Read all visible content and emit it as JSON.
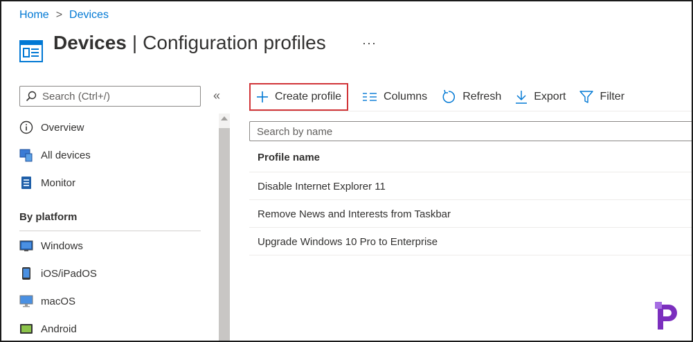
{
  "breadcrumb": {
    "home": "Home",
    "separator": ">",
    "current": "Devices"
  },
  "header": {
    "title_bold": "Devices",
    "title_bar": "|",
    "title_rest": "Configuration profiles",
    "more": "···",
    "icon": "configuration-profile-icon"
  },
  "nav": {
    "search_placeholder": "Search (Ctrl+/)",
    "collapse": "«",
    "items": [
      {
        "label": "Overview",
        "icon": "info-icon"
      },
      {
        "label": "All devices",
        "icon": "devices-icon"
      },
      {
        "label": "Monitor",
        "icon": "monitor-icon"
      }
    ],
    "section": "By platform",
    "platforms": [
      {
        "label": "Windows",
        "icon": "windows-icon"
      },
      {
        "label": "iOS/iPadOS",
        "icon": "ios-icon"
      },
      {
        "label": "macOS",
        "icon": "macos-icon"
      },
      {
        "label": "Android",
        "icon": "android-icon"
      }
    ]
  },
  "toolbar": {
    "create": "Create profile",
    "columns": "Columns",
    "refresh": "Refresh",
    "export": "Export",
    "filter": "Filter"
  },
  "main": {
    "search_placeholder": "Search by name",
    "column_header": "Profile name",
    "rows": [
      "Disable Internet Explorer 11",
      "Remove News and Interests from Taskbar",
      "Upgrade Windows 10 Pro to Enterprise"
    ]
  },
  "colors": {
    "accent": "#0078d4",
    "highlight": "#d13438",
    "logo": "#7b2fbe"
  }
}
